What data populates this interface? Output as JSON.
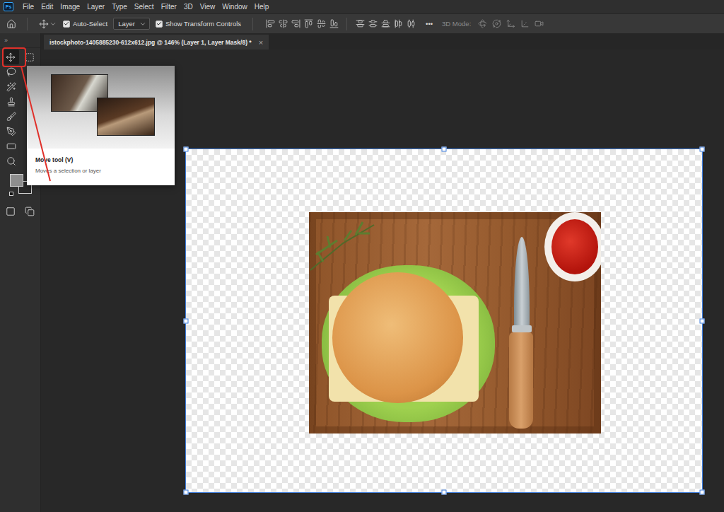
{
  "app": {
    "logo": "Ps"
  },
  "menu": [
    "File",
    "Edit",
    "Image",
    "Layer",
    "Type",
    "Select",
    "Filter",
    "3D",
    "View",
    "Window",
    "Help"
  ],
  "options_bar": {
    "auto_select": {
      "label": "Auto-Select",
      "checked": true
    },
    "target": {
      "value": "Layer"
    },
    "show_transform_controls": {
      "label": "Show Transform Controls",
      "checked": true
    },
    "more": "•••",
    "mode_3d": {
      "label": "3D Mode:",
      "disabled": true
    }
  },
  "toolbar": {
    "toggle": "»"
  },
  "document_tab": {
    "title": "istockphoto-1405885230-612x612.jpg @ 146% (Layer 1, Layer Mask/8) *",
    "close": "×"
  },
  "tools": [
    {
      "kind": "move",
      "selected": true
    },
    {
      "kind": "marquee",
      "selected": false
    },
    {
      "kind": "lasso",
      "selected": false
    },
    {
      "kind": "quickselect",
      "selected": false
    },
    {
      "kind": "stamp",
      "selected": false
    },
    {
      "kind": "brush",
      "selected": false
    },
    {
      "kind": "pen",
      "selected": false
    },
    {
      "kind": "rectangle",
      "selected": false
    },
    {
      "kind": "zoom",
      "selected": false
    },
    {
      "kind": "quickmask",
      "selected": false
    },
    {
      "kind": "screenmode",
      "selected": false
    }
  ],
  "colors": {
    "foreground": "#8e8e8e",
    "background": "#2a2a2a"
  },
  "tooltip": {
    "title": "Move tool (V)",
    "description": "Moves a selection or layer"
  }
}
